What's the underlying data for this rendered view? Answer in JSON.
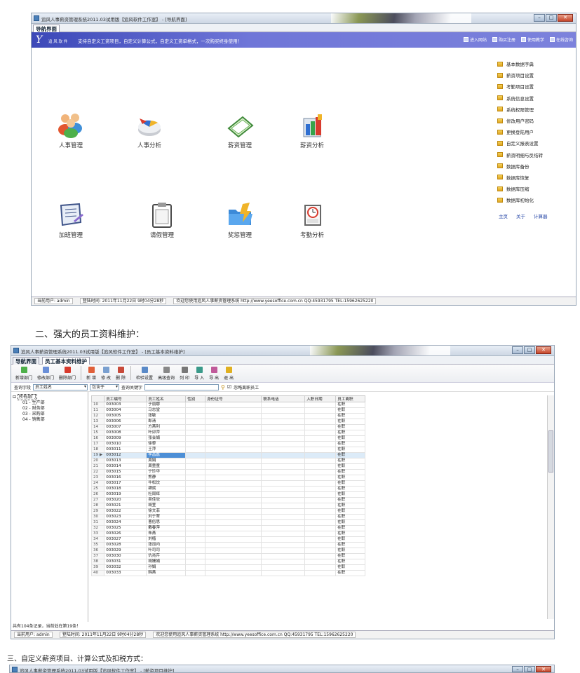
{
  "window1": {
    "title": "追风人事薪资管理系统2011.03试用版【追风软件工作室】 - [导航界面]",
    "tab": "导航界面",
    "banner": {
      "logo": "Y",
      "company": "追 风 软 件",
      "slogan": "支持自定义工资项目，自定义计算公式，自定义工资单格式，一次购买终身使用！",
      "links": [
        "进入网站",
        "购买注册",
        "使用教学",
        "在线咨询"
      ]
    },
    "modules": [
      {
        "label": "人事管理",
        "icon": "people-icon"
      },
      {
        "label": "人事分析",
        "icon": "pie-chart-icon"
      },
      {
        "label": "薪资管理",
        "icon": "money-icon"
      },
      {
        "label": "薪资分析",
        "icon": "bar-chart-icon"
      },
      {
        "label": "加班管理",
        "icon": "clipboard-icon"
      },
      {
        "label": "请假管理",
        "icon": "notepad-icon"
      },
      {
        "label": "奖惩管理",
        "icon": "folder-icon"
      },
      {
        "label": "考勤分析",
        "icon": "clock-icon"
      }
    ],
    "right_menu": [
      "基本数据字典",
      "薪资项目设置",
      "考勤项目设置",
      "系统信息设置",
      "系统权限管理",
      "修改用户密码",
      "更换登陆用户",
      "自定义报表设置",
      "薪资明细与反结转",
      "数据库备份",
      "数据库恢复",
      "数据库压缩",
      "数据库初始化"
    ],
    "right_links": [
      "主页",
      "关于",
      "计算器"
    ],
    "status": {
      "user": "当前用户: admin",
      "login": "登陆时间: 2011年11月22日 9时04分28秒",
      "welcome": "欢迎您使用追风人事薪资管理系统 http://www.yeesoffice.com.cn QQ:45931795 TEL:15962625220"
    }
  },
  "caption2": "二、强大的员工资料维护：",
  "window2": {
    "title": "追风人事薪资管理系统2011.03试用版【追风软件工作室】 - [员工基本资料维护]",
    "tabs": [
      "导航界面",
      "员工基本资料维护"
    ],
    "toolbar": [
      "新增部门",
      "修改部门",
      "删除部门",
      "新",
      "增",
      "修",
      "改",
      "删",
      "除",
      "检验设置",
      "高级查询",
      "列",
      "印",
      "导",
      "入",
      "导",
      "出",
      "退",
      "出"
    ],
    "query": {
      "field_label": "查询字段",
      "field_value": "员工姓名",
      "op_value": "包含于",
      "keyword_label": "查询关键字",
      "check_label": "忽略离职员工"
    },
    "tree": [
      "所有部门",
      "01 - 生产部",
      "02 - 财务部",
      "03 - 采购部",
      "04 - 销售部"
    ],
    "columns": [
      "员工编号",
      "员工姓名",
      "性别",
      "身份证号",
      "联系电话",
      "入职日期",
      "员工离职"
    ],
    "rows": [
      [
        "10",
        "003003",
        "于丽娜",
        "在职"
      ],
      [
        "11",
        "003004",
        "马志堂",
        "在职"
      ],
      [
        "12",
        "003005",
        "张敏",
        "在职"
      ],
      [
        "13",
        "003006",
        "郎清",
        "在职"
      ],
      [
        "14",
        "003007",
        "方燕利",
        "在职"
      ],
      [
        "15",
        "003008",
        "叶卯萍",
        "在职"
      ],
      [
        "16",
        "003009",
        "张会娟",
        "在职"
      ],
      [
        "17",
        "003010",
        "徐黎",
        "在职"
      ],
      [
        "18",
        "003011",
        "王萍",
        "在职"
      ],
      [
        "19 ▶",
        "003012",
        "李昌磊",
        "在职"
      ],
      [
        "20",
        "003013",
        "周娟",
        "在职"
      ],
      [
        "21",
        "003014",
        "周童童",
        "在职"
      ],
      [
        "22",
        "003015",
        "宁珍华",
        "在职"
      ],
      [
        "23",
        "003016",
        "熊静",
        "在职"
      ],
      [
        "24",
        "003017",
        "牛松饮",
        "在职"
      ],
      [
        "25",
        "003018",
        "肆斌",
        "在职"
      ],
      [
        "26",
        "003019",
        "杜周辉",
        "在职"
      ],
      [
        "27",
        "003020",
        "吴佳欣",
        "在职"
      ],
      [
        "28",
        "003021",
        "胡萱",
        "在职"
      ],
      [
        "29",
        "003022",
        "徐文菲",
        "在职"
      ],
      [
        "30",
        "003023",
        "刘于翠",
        "在职"
      ],
      [
        "31",
        "003024",
        "曹俗思",
        "在职"
      ],
      [
        "32",
        "003025",
        "戴春萍",
        "在职"
      ],
      [
        "33",
        "003026",
        "朱燕",
        "在职"
      ],
      [
        "34",
        "003027",
        "刘楷",
        "在职"
      ],
      [
        "35",
        "003028",
        "张加内",
        "在职"
      ],
      [
        "36",
        "003029",
        "叶司司",
        "在职"
      ],
      [
        "37",
        "003030",
        "仇兆芹",
        "在职"
      ],
      [
        "38",
        "003031",
        "胡姗娟",
        "在职"
      ],
      [
        "39",
        "003032",
        "孙娟",
        "在职"
      ],
      [
        "40",
        "003033",
        "韩燕",
        "在职"
      ]
    ],
    "footer": "共有104条记录，当前处在第19条！",
    "status": {
      "user": "当前用户: admin",
      "login": "登陆时间: 2011年11月22日 9时04分28秒",
      "welcome": "欢迎您使用追风人事薪资管理系统 http://www.yeesoffice.com.cn QQ:45931795 TEL:15962625220"
    }
  },
  "caption3": "三、自定义薪资项目、计算公式及扣税方式：",
  "window3": {
    "title": "追风人事薪资管理系统2011.03试用版【追风软件工作室】 - [薪资项目维护]"
  }
}
